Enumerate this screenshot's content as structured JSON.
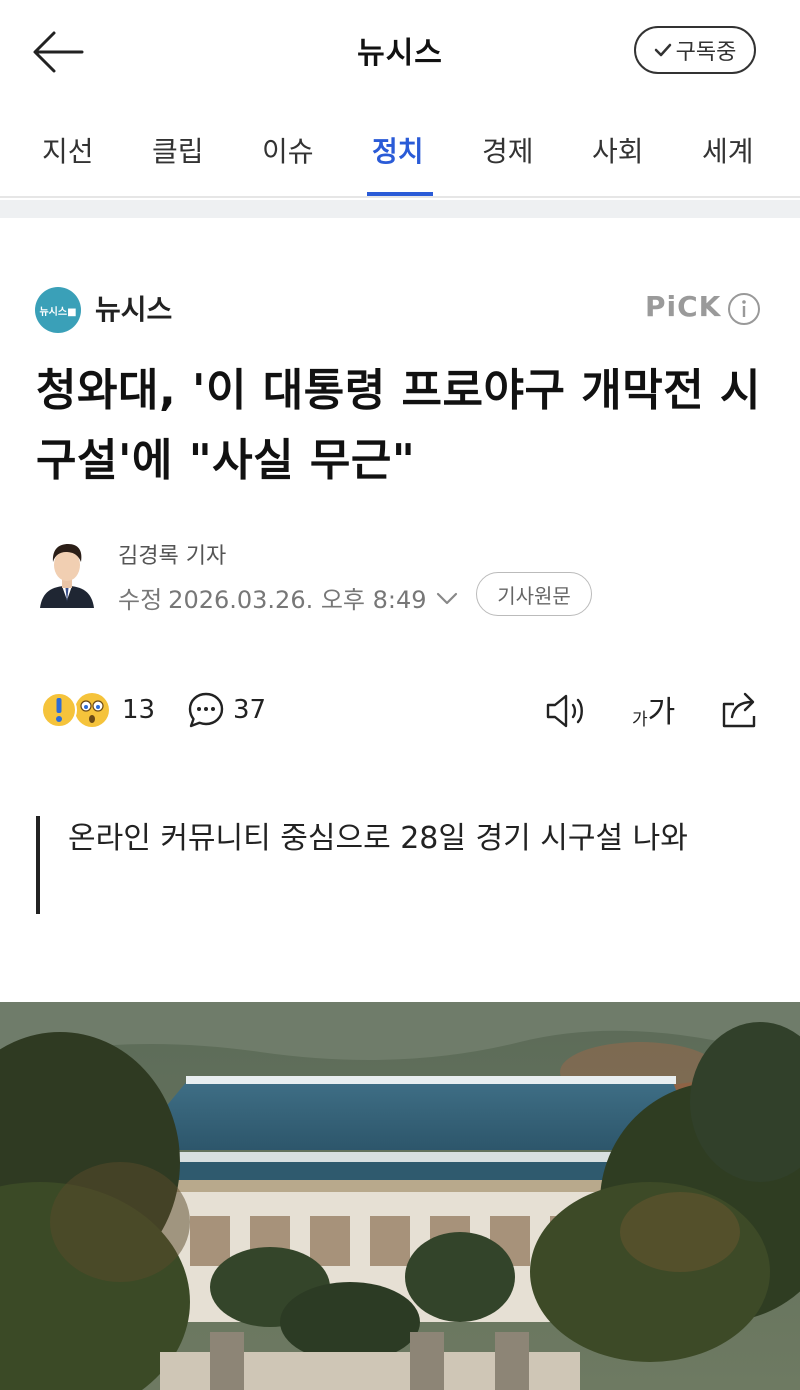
{
  "header": {
    "title": "뉴시스",
    "subscribe_label": "구독중"
  },
  "tabs": [
    {
      "label": "지선"
    },
    {
      "label": "클립"
    },
    {
      "label": "이슈"
    },
    {
      "label": "정치",
      "active": true
    },
    {
      "label": "경제"
    },
    {
      "label": "사회"
    },
    {
      "label": "세계"
    }
  ],
  "press": {
    "name": "뉴시스",
    "logo_text": "뉴시스■",
    "pick_label": "PiCK",
    "brand_color": "#3aa0b8"
  },
  "article": {
    "title": "청와대, '이 대통령 프로야구 개막전 시구설'에 \"사실 무근\"",
    "reporter": "김경록 기자",
    "date_label": "수정",
    "date": "2026.03.26. 오후 8:49",
    "original_label": "기사원문",
    "summary": "온라인 커뮤니티 중심으로 28일 경기 시구설 나와"
  },
  "actions": {
    "reaction_count": "13",
    "comment_count": "37",
    "font_small": "가",
    "font_big": "가"
  },
  "icons": [
    "back-arrow-icon",
    "check-icon",
    "info-icon",
    "chevron-down-icon",
    "reaction-icon",
    "comment-icon",
    "speaker-icon",
    "share-icon"
  ],
  "colors": {
    "accent": "#2a5bd7",
    "divider": "#eef0f2"
  }
}
